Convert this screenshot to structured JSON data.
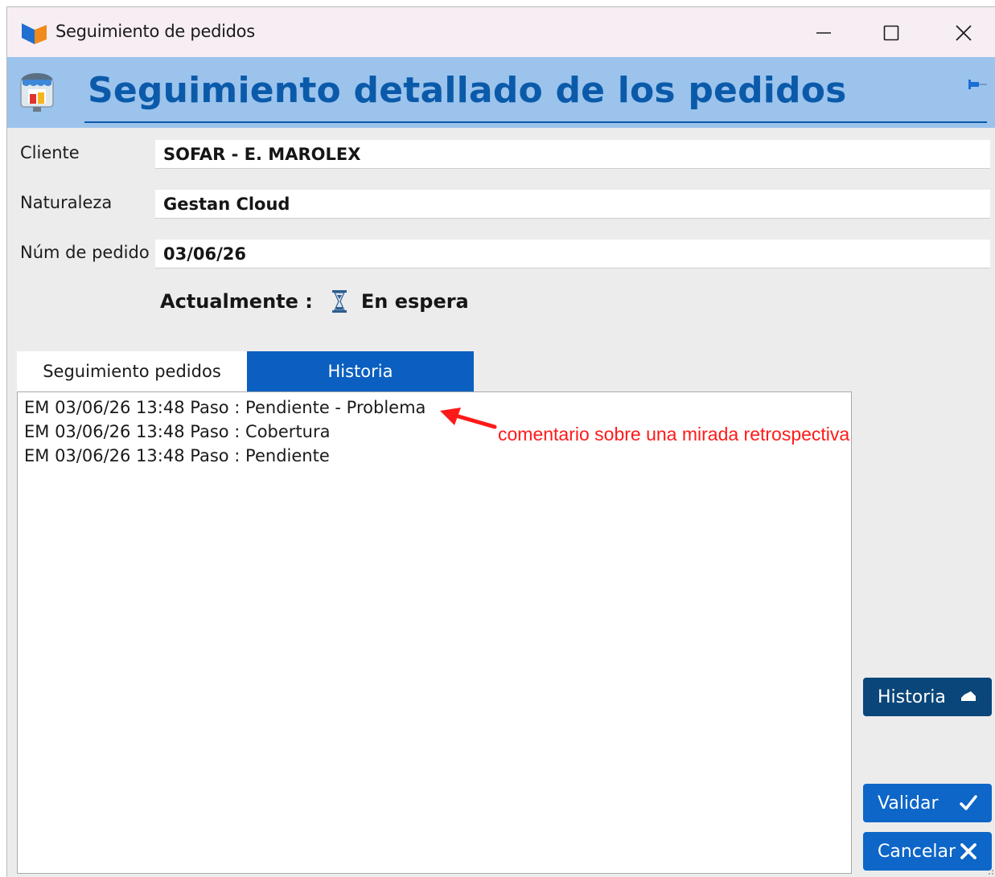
{
  "window": {
    "title": "Seguimiento de pedidos"
  },
  "header": {
    "title": "Seguimiento detallado de los pedidos"
  },
  "form": {
    "cliente": {
      "label": "Cliente",
      "value": "SOFAR - E. MAROLEX"
    },
    "naturaleza": {
      "label": "Naturaleza",
      "value": "Gestan Cloud"
    },
    "num_pedido": {
      "label": "Núm de pedido",
      "value": "03/06/26"
    }
  },
  "status": {
    "label": "Actualmente :",
    "value": "En espera",
    "icon": "hourglass-icon"
  },
  "tabs": [
    {
      "label": "Seguimiento pedidos",
      "active": true
    },
    {
      "label": "Historia",
      "active": false
    }
  ],
  "history": {
    "items": [
      "EM 03/06/26 13:48 Paso : Pendiente - Problema",
      "EM 03/06/26 13:48 Paso : Cobertura",
      "EM 03/06/26 13:48 Paso : Pendiente"
    ]
  },
  "annotation": {
    "text": "comentario sobre una mirada retrospectiva",
    "color": "#ff1a1a"
  },
  "buttons": {
    "historia": "Historia",
    "validar": "Validar",
    "cancelar": "Cancelar"
  },
  "colors": {
    "header_band": "#9bc3ec",
    "header_title": "#0b5aaa",
    "tab_inactive": "#0b5fc0",
    "button_dark": "#0a4679",
    "button_blue": "#0d66c8"
  }
}
